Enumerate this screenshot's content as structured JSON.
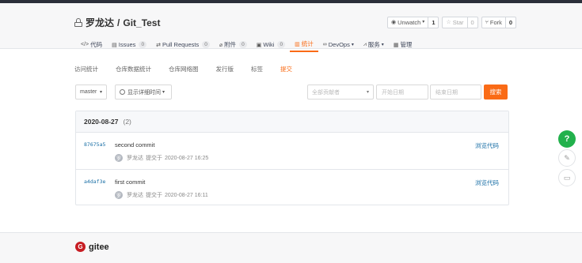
{
  "repo": {
    "owner": "罗龙达",
    "separator": "/",
    "name": "Git_Test"
  },
  "actions": {
    "watch": {
      "label": "Unwatch",
      "count": "1"
    },
    "star": {
      "label": "Star",
      "count": "0"
    },
    "fork": {
      "label": "Fork",
      "count": "0"
    }
  },
  "nav": {
    "code": "代码",
    "issues": {
      "label": "Issues",
      "count": "0"
    },
    "pulls": {
      "label": "Pull Requests",
      "count": "0"
    },
    "attachments": {
      "label": "附件",
      "count": "0"
    },
    "wiki": {
      "label": "Wiki",
      "count": "0"
    },
    "stats": "统计",
    "devops": "DevOps",
    "services": "服务",
    "manage": "管理"
  },
  "subtabs": [
    "访问统计",
    "仓库数据统计",
    "仓库网络图",
    "发行版",
    "标签",
    "提交"
  ],
  "filters": {
    "branch": "master",
    "detail_toggle": "显示详细时间",
    "author_placeholder": "全部贡献者",
    "start_placeholder": "开始日期",
    "end_placeholder": "结束日期",
    "search_label": "搜索"
  },
  "commit_group": {
    "date": "2020-08-27",
    "count": "(2)"
  },
  "commits": [
    {
      "sha": "87675a5",
      "message": "second commit",
      "avatar": "罗",
      "author": "罗龙达",
      "action": "提交于",
      "time": "2020-08-27 16:25",
      "browse": "浏览代码"
    },
    {
      "sha": "a4daf3e",
      "message": "first commit",
      "avatar": "罗",
      "author": "罗龙达",
      "action": "提交于",
      "time": "2020-08-27 16:11",
      "browse": "浏览代码"
    }
  ],
  "footer": {
    "logo_mark": "G",
    "brand": "gitee"
  },
  "colors": {
    "accent": "#fa6b16",
    "link": "#1a6fa6",
    "help": "#22b14c",
    "brand": "#c71d23"
  },
  "icons": [
    "lock-icon",
    "eye-icon",
    "star-icon",
    "fork-icon",
    "code-icon",
    "issues-icon",
    "pull-request-icon",
    "attachment-icon",
    "wiki-icon",
    "stats-icon",
    "devops-icon",
    "services-icon",
    "manage-icon",
    "clock-icon",
    "help-icon",
    "edit-icon",
    "chat-icon"
  ]
}
